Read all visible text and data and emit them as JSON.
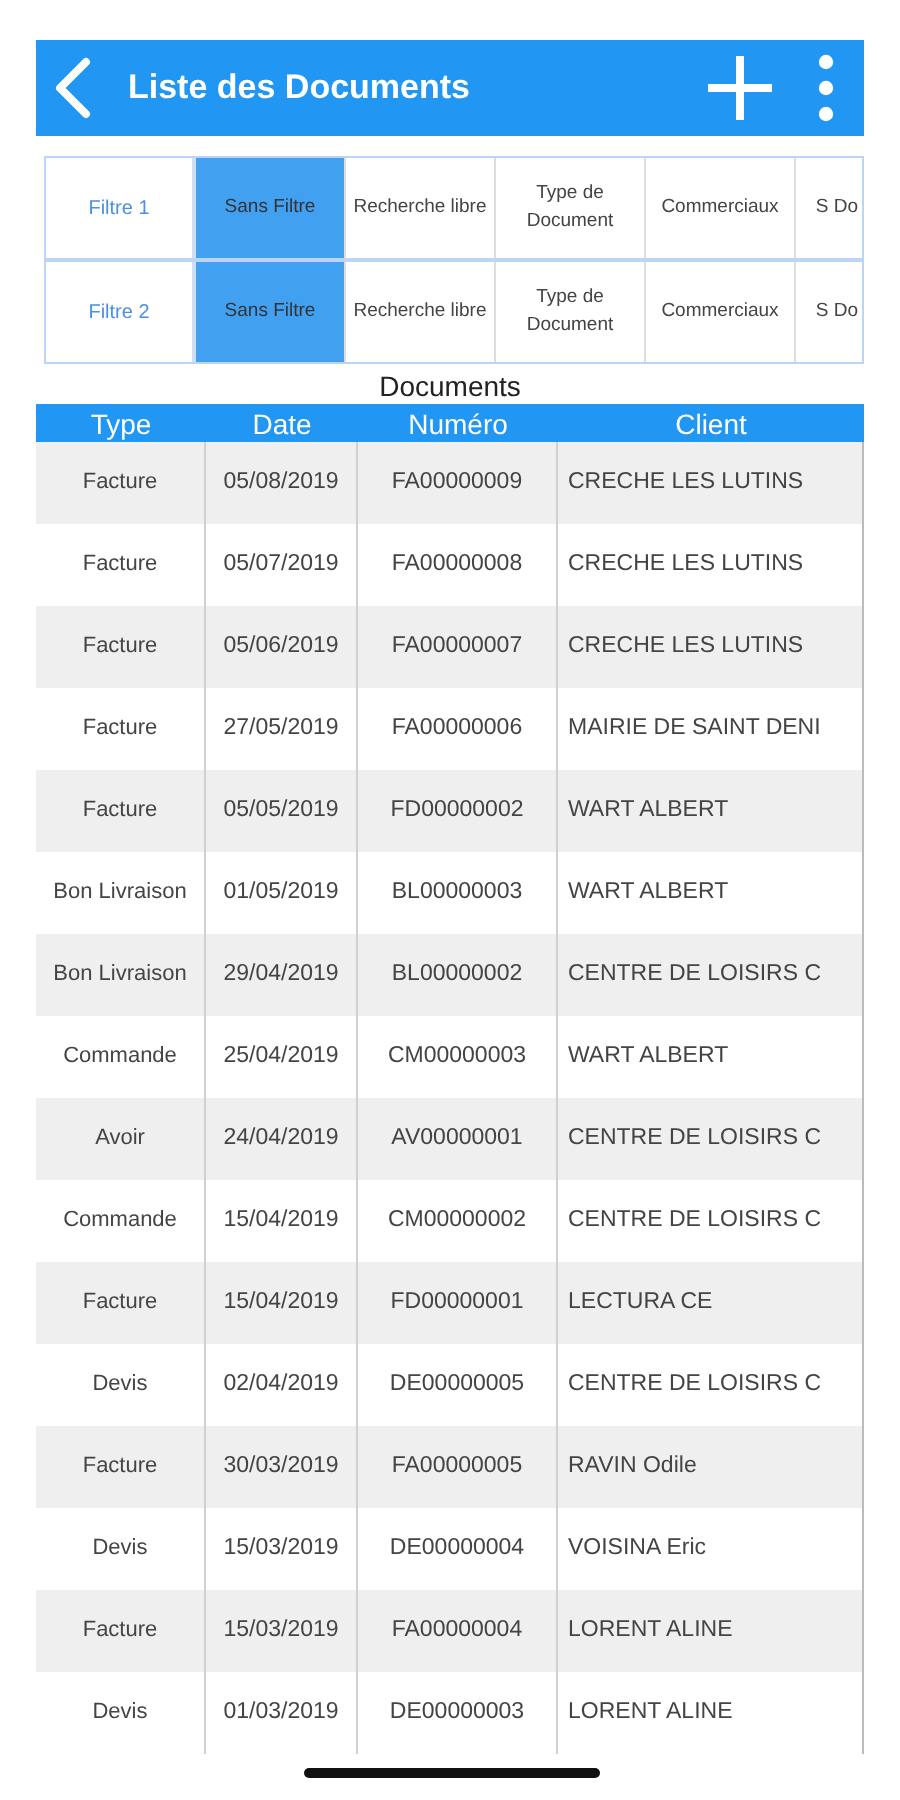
{
  "header": {
    "title": "Liste des Documents"
  },
  "filters": [
    {
      "label": "Filtre 1",
      "options": [
        {
          "text": "Sans Filtre",
          "selected": true
        },
        {
          "text": "Recherche libre",
          "selected": false
        },
        {
          "text": "Type de Document",
          "selected": false
        },
        {
          "text": "Commerciaux",
          "selected": false
        },
        {
          "text": "S Do",
          "selected": false
        }
      ]
    },
    {
      "label": "Filtre 2",
      "options": [
        {
          "text": "Sans Filtre",
          "selected": true
        },
        {
          "text": "Recherche libre",
          "selected": false
        },
        {
          "text": "Type de Document",
          "selected": false
        },
        {
          "text": "Commerciaux",
          "selected": false
        },
        {
          "text": "S Do",
          "selected": false
        }
      ]
    }
  ],
  "table": {
    "title": "Documents",
    "columns": [
      "Type",
      "Date",
      "Numéro",
      "Client"
    ],
    "rows": [
      [
        "Facture",
        "05/08/2019",
        "FA00000009",
        "CRECHE LES LUTINS"
      ],
      [
        "Facture",
        "05/07/2019",
        "FA00000008",
        "CRECHE LES LUTINS"
      ],
      [
        "Facture",
        "05/06/2019",
        "FA00000007",
        "CRECHE LES LUTINS"
      ],
      [
        "Facture",
        "27/05/2019",
        "FA00000006",
        "MAIRIE DE SAINT DENI"
      ],
      [
        "Facture",
        "05/05/2019",
        "FD00000002",
        "WART ALBERT"
      ],
      [
        "Bon Livraison",
        "01/05/2019",
        "BL00000003",
        "WART ALBERT"
      ],
      [
        "Bon Livraison",
        "29/04/2019",
        "BL00000002",
        "CENTRE DE LOISIRS C"
      ],
      [
        "Commande",
        "25/04/2019",
        "CM00000003",
        "WART ALBERT"
      ],
      [
        "Avoir",
        "24/04/2019",
        "AV00000001",
        "CENTRE DE LOISIRS C"
      ],
      [
        "Commande",
        "15/04/2019",
        "CM00000002",
        "CENTRE DE LOISIRS C"
      ],
      [
        "Facture",
        "15/04/2019",
        "FD00000001",
        "LECTURA CE"
      ],
      [
        "Devis",
        "02/04/2019",
        "DE00000005",
        "CENTRE DE LOISIRS C"
      ],
      [
        "Facture",
        "30/03/2019",
        "FA00000005",
        "RAVIN Odile"
      ],
      [
        "Devis",
        "15/03/2019",
        "DE00000004",
        "VOISINA Eric"
      ],
      [
        "Facture",
        "15/03/2019",
        "FA00000004",
        "LORENT ALINE"
      ],
      [
        "Devis",
        "01/03/2019",
        "DE00000003",
        "LORENT ALINE"
      ]
    ]
  }
}
